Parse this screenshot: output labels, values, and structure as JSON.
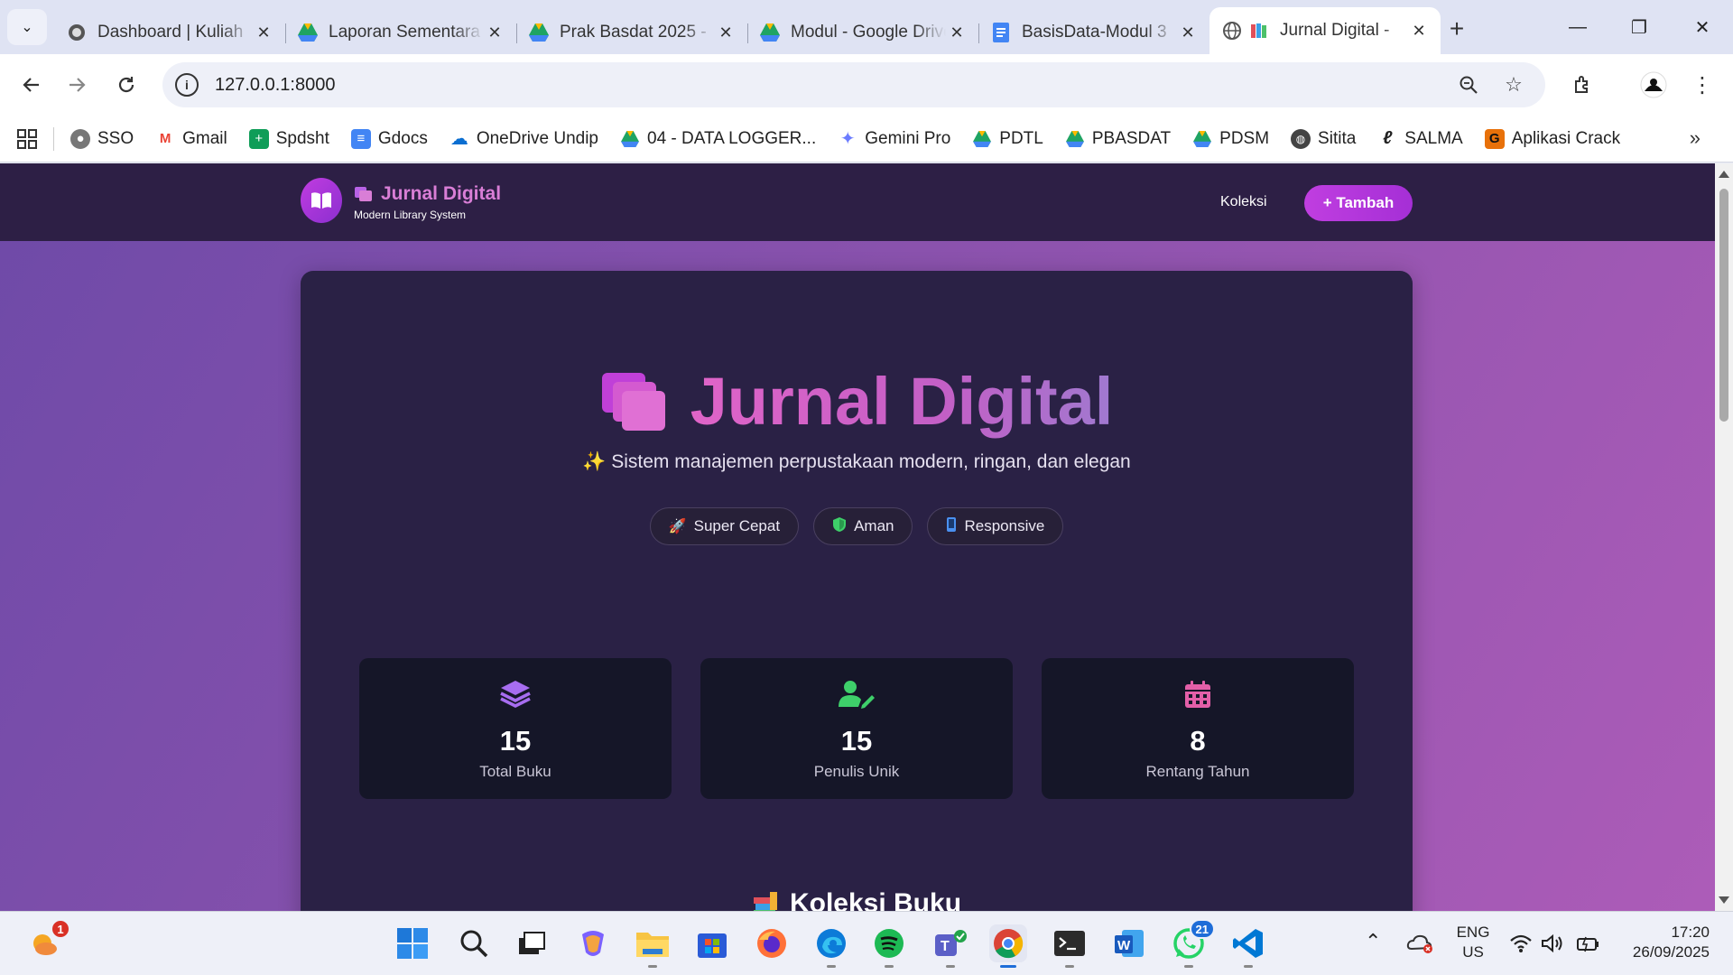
{
  "browser": {
    "tabs": [
      {
        "title": "Dashboard | Kuliah",
        "icon": "moodle-icon",
        "color": "#444444"
      },
      {
        "title": "Laporan Sementara",
        "icon": "drive-icon",
        "color": "#1fa463"
      },
      {
        "title": "Prak Basdat 2025 -",
        "icon": "drive-icon",
        "color": "#1fa463"
      },
      {
        "title": "Modul - Google Drive",
        "icon": "drive-icon",
        "color": "#1fa463"
      },
      {
        "title": "BasisData-Modul 3",
        "icon": "docs-icon",
        "color": "#4285f4"
      },
      {
        "title": "Jurnal Digital -",
        "icon": "books-icon",
        "color": "#c13ce0",
        "active": true
      }
    ],
    "url": "127.0.0.1:8000",
    "bookmarks": [
      {
        "label": "SSO",
        "icon": "sso-icon",
        "color": "#666666"
      },
      {
        "label": "Gmail",
        "icon": "gmail-icon",
        "color": "#ea4335"
      },
      {
        "label": "Spdsht",
        "icon": "sheets-icon",
        "color": "#0f9d58"
      },
      {
        "label": "Gdocs",
        "icon": "docs-icon",
        "color": "#4285f4"
      },
      {
        "label": "OneDrive Undip",
        "icon": "onedrive-icon",
        "color": "#0a6ed1"
      },
      {
        "label": "04 - DATA LOGGER...",
        "icon": "drive-icon",
        "color": "#1fa463"
      },
      {
        "label": "Gemini Pro",
        "icon": "gemini-icon",
        "color": "#6b7cff"
      },
      {
        "label": "PDTL",
        "icon": "drive-icon",
        "color": "#1fa463"
      },
      {
        "label": "PBASDAT",
        "icon": "drive-icon",
        "color": "#1fa463"
      },
      {
        "label": "PDSM",
        "icon": "drive-icon",
        "color": "#1fa463"
      },
      {
        "label": "Sitita",
        "icon": "globe-icon",
        "color": "#444444"
      },
      {
        "label": "SALMA",
        "icon": "salma-icon",
        "color": "#333333"
      },
      {
        "label": "Aplikasi Crack",
        "icon": "g-icon",
        "color": "#e8710a"
      }
    ]
  },
  "site": {
    "brand": "Jurnal Digital",
    "tagline": "Modern Library System",
    "nav_link": "Koleksi",
    "add_button": "+ Tambah",
    "hero_title": "Jurnal Digital",
    "hero_subtitle": "✨ Sistem manajemen perpustakaan modern, ringan, dan elegan",
    "pills": [
      {
        "label": "Super Cepat",
        "icon": "rocket-icon",
        "color": "#b06ae8"
      },
      {
        "label": "Aman",
        "icon": "shield-icon",
        "color": "#3ecf6a"
      },
      {
        "label": "Responsive",
        "icon": "mobile-icon",
        "color": "#4a90f0"
      }
    ],
    "stats": [
      {
        "value": "15",
        "label": "Total Buku",
        "icon": "layers-icon",
        "color": "#a76df0"
      },
      {
        "value": "15",
        "label": "Penulis Unik",
        "icon": "user-pen-icon",
        "color": "#3ecf6a"
      },
      {
        "value": "8",
        "label": "Rentang Tahun",
        "icon": "calendar-icon",
        "color": "#e35fa8"
      }
    ],
    "section_title": "Koleksi Buku"
  },
  "taskbar": {
    "weather_badge": "1",
    "whatsapp_badge": "21",
    "lang": "ENG",
    "region": "US",
    "time": "17:20",
    "date": "26/09/2025"
  }
}
